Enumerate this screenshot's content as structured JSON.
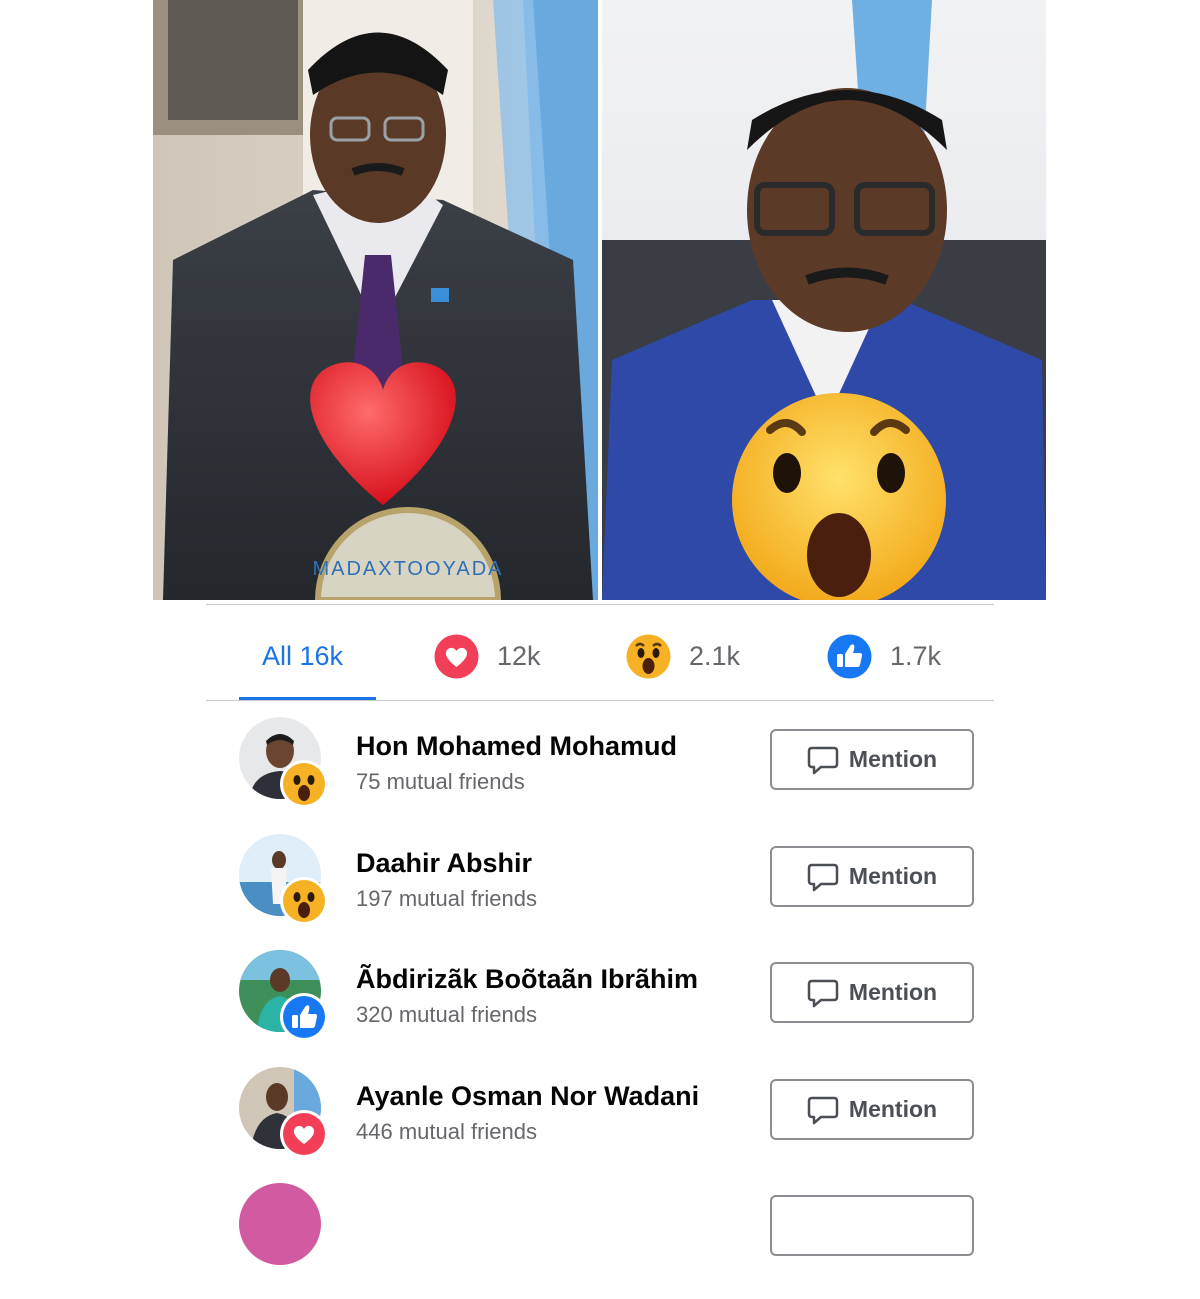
{
  "post_image": {
    "seal_text": "MADAXTOOYADA",
    "left_overlay_icon": "heart-reaction-icon",
    "right_overlay_icon": "wow-reaction-icon"
  },
  "tabs": [
    {
      "label": "All 16k",
      "icon": "",
      "selected": true
    },
    {
      "label": "12k",
      "icon": "love-reaction-icon",
      "selected": false
    },
    {
      "label": "2.1k",
      "icon": "wow-reaction-icon",
      "selected": false
    },
    {
      "label": "1.7k",
      "icon": "like-reaction-icon",
      "selected": false
    }
  ],
  "reactors": [
    {
      "name": "Hon Mohamed Mohamud",
      "mutual": "75 mutual friends",
      "reaction": "wow-reaction-icon",
      "button": "Mention"
    },
    {
      "name": "Daahir Abshir",
      "mutual": "197 mutual friends",
      "reaction": "wow-reaction-icon",
      "button": "Mention"
    },
    {
      "name": "Ãbdirizãk Boõtaãn Ibrãhim",
      "mutual": "320 mutual friends",
      "reaction": "like-reaction-icon",
      "button": "Mention"
    },
    {
      "name": "Ayanle Osman Nor Wadani",
      "mutual": "446 mutual friends",
      "reaction": "love-reaction-icon",
      "button": "Mention"
    }
  ],
  "colors": {
    "accent": "#1b74e4",
    "love": "#f33e58",
    "wow": "#f7b125",
    "like": "#1877f2"
  }
}
